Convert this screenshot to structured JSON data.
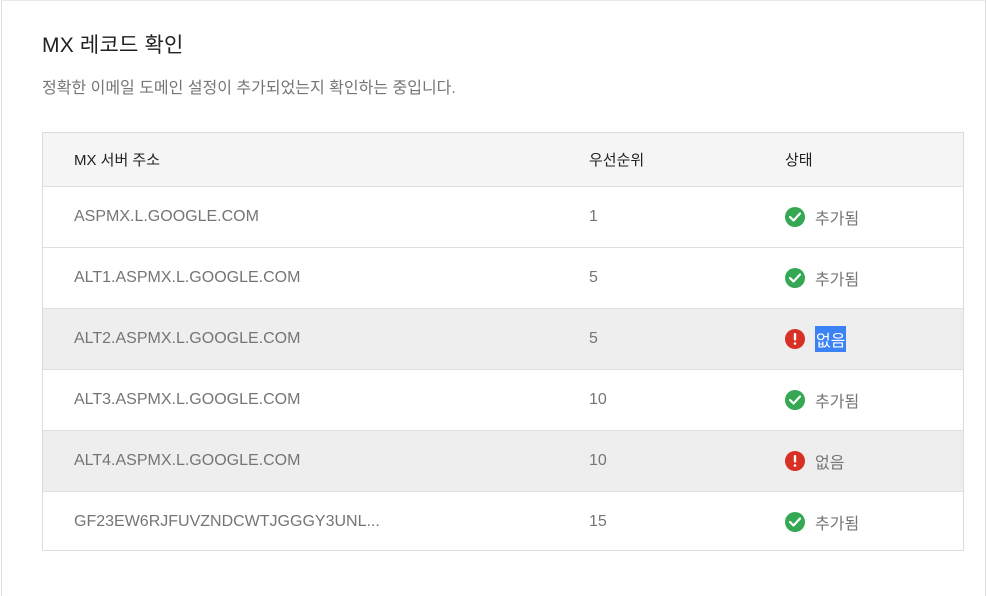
{
  "title": "MX 레코드 확인",
  "subtitle": "정확한 이메일 도메인 설정이 추가되었는지 확인하는 중입니다.",
  "table": {
    "headers": [
      "MX 서버 주소",
      "우선순위",
      "상태"
    ],
    "rows": [
      {
        "server": "ASPMX.L.GOOGLE.COM",
        "priority": "1",
        "status": "추가됨",
        "state": "ok",
        "status_icon": "check-circle-icon"
      },
      {
        "server": "ALT1.ASPMX.L.GOOGLE.COM",
        "priority": "5",
        "status": "추가됨",
        "state": "ok",
        "status_icon": "check-circle-icon"
      },
      {
        "server": "ALT2.ASPMX.L.GOOGLE.COM",
        "priority": "5",
        "status": "없음",
        "state": "error",
        "status_icon": "error-circle-icon"
      },
      {
        "server": "ALT3.ASPMX.L.GOOGLE.COM",
        "priority": "10",
        "status": "추가됨",
        "state": "ok",
        "status_icon": "check-circle-icon"
      },
      {
        "server": "ALT4.ASPMX.L.GOOGLE.COM",
        "priority": "10",
        "status": "없음",
        "state": "error",
        "status_icon": "error-circle-icon"
      },
      {
        "server": "GF23EW6RJFUVZNDCWTJGGGY3UNL...",
        "priority": "15",
        "status": "추가됨",
        "state": "ok",
        "status_icon": "check-circle-icon"
      }
    ]
  },
  "colors": {
    "ok": "#34a853",
    "error": "#d93025",
    "selection": "#3b82f6"
  }
}
